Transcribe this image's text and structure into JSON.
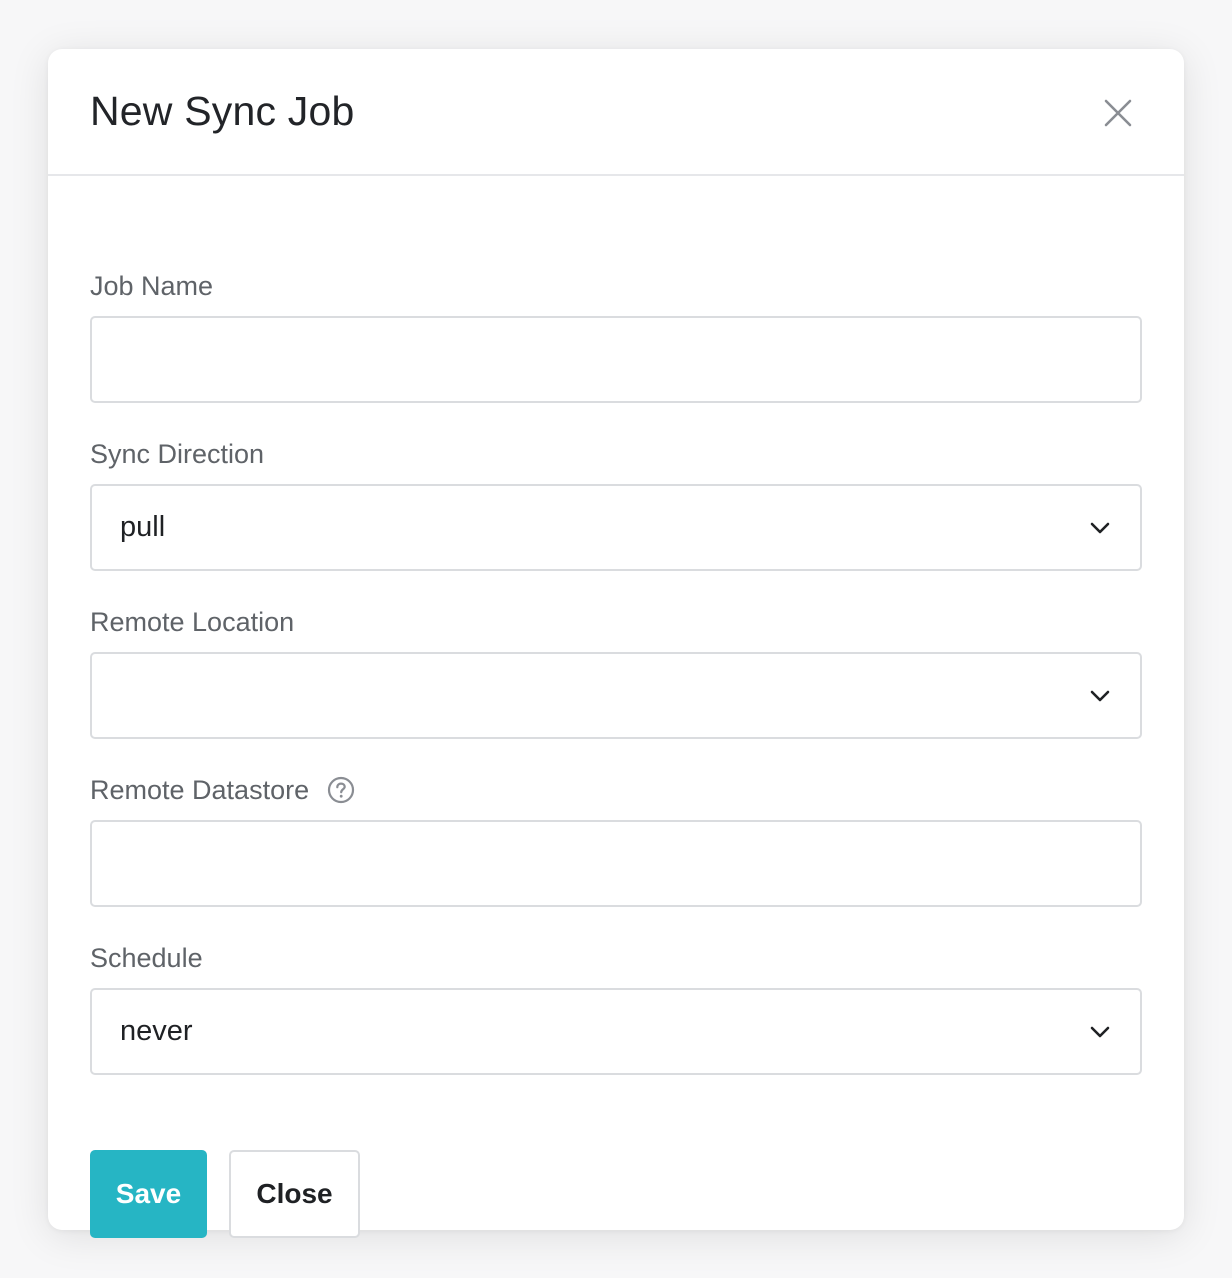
{
  "dialog": {
    "title": "New Sync Job",
    "close_icon": "close-icon"
  },
  "fields": {
    "job_name": {
      "label": "Job Name",
      "value": "",
      "placeholder": ""
    },
    "sync_direction": {
      "label": "Sync Direction",
      "value": "pull"
    },
    "remote_location": {
      "label": "Remote Location",
      "value": ""
    },
    "remote_datastore": {
      "label": "Remote Datastore",
      "value": "",
      "help_icon": "help-circle-icon"
    },
    "schedule": {
      "label": "Schedule",
      "value": "never"
    }
  },
  "buttons": {
    "save_label": "Save",
    "close_label": "Close"
  },
  "colors": {
    "primary": "#26b5c4",
    "border": "#dadcdf",
    "label": "#5f6368"
  }
}
